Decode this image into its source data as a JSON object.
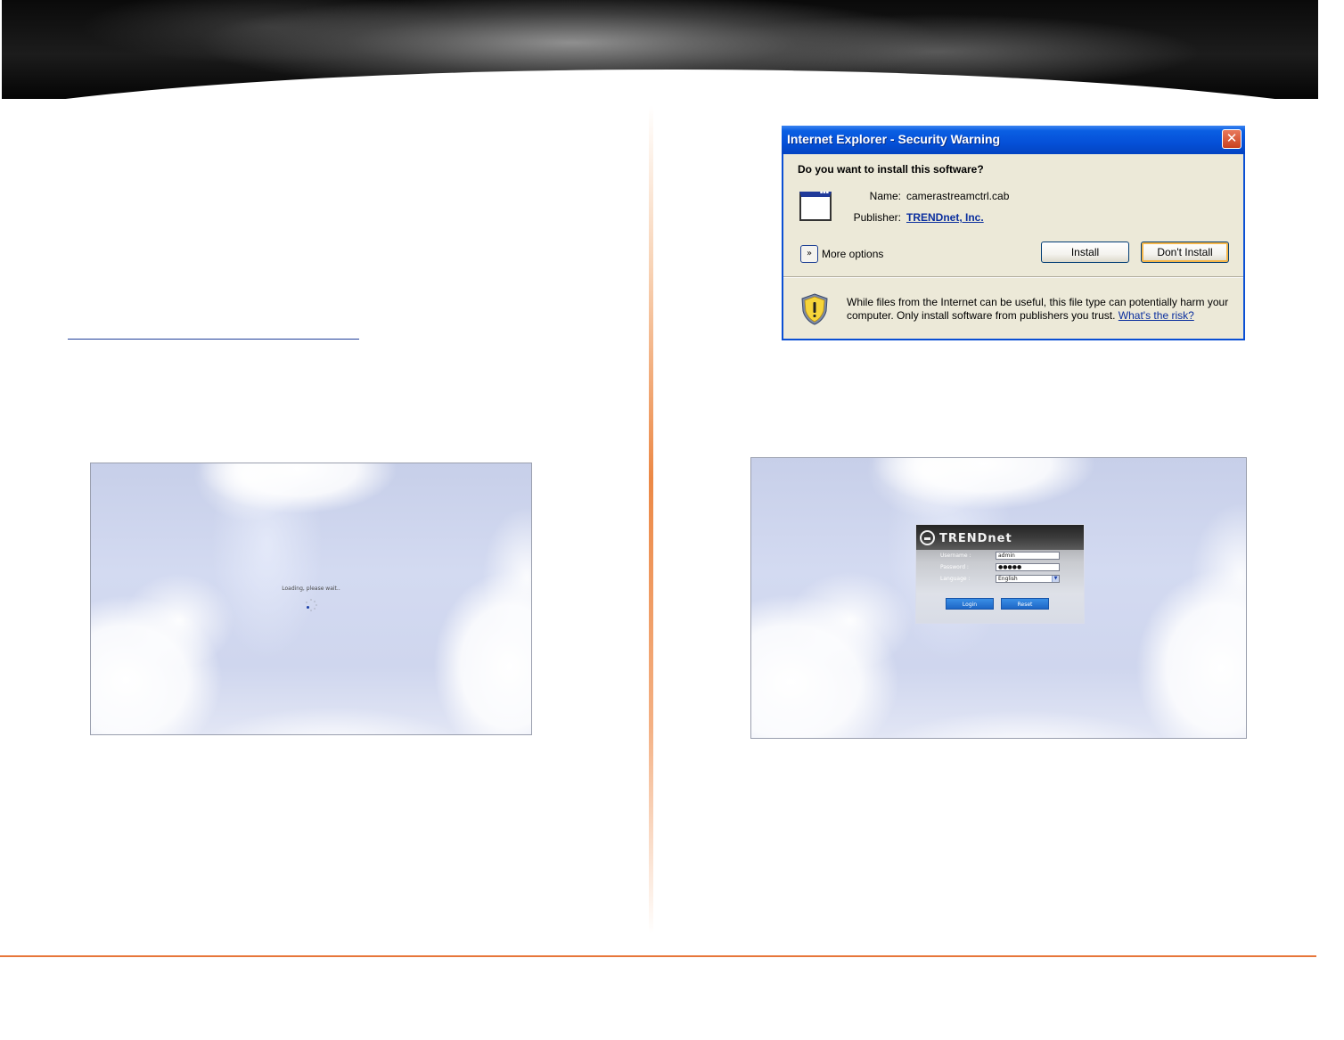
{
  "dialog": {
    "title": "Internet Explorer - Security Warning",
    "close_glyph": "✕",
    "question": "Do you want to install this software?",
    "name_label": "Name:",
    "name_value": "camerastreamctrl.cab",
    "publisher_label": "Publisher:",
    "publisher_value": "TRENDnet, Inc.",
    "more_options_glyph": "»",
    "more_options": "More options",
    "install_button": "Install",
    "dont_install_button": "Don't Install",
    "warning_text": "While files from the Internet can be useful, this file type can potentially harm your computer. Only install software from publishers you trust.",
    "risk_link": "What's the risk?"
  },
  "loading_screen": {
    "message": "Loading, please wait.."
  },
  "login_screen": {
    "brand": "TRENDnet",
    "username_label": "Username :",
    "username_value": "admin",
    "password_label": "Password :",
    "password_value": "●●●●●",
    "language_label": "Language :",
    "language_value": "English",
    "login_button": "Login",
    "reset_button": "Reset"
  },
  "icons": {
    "shield": "shield-warning-icon",
    "file": "window-file-icon",
    "close": "close-icon",
    "expand": "expand-chevron-icon"
  },
  "colors": {
    "accent_line": "#e7763a",
    "dialog_title": "#0550d8",
    "login_button": "#1d66c6"
  }
}
